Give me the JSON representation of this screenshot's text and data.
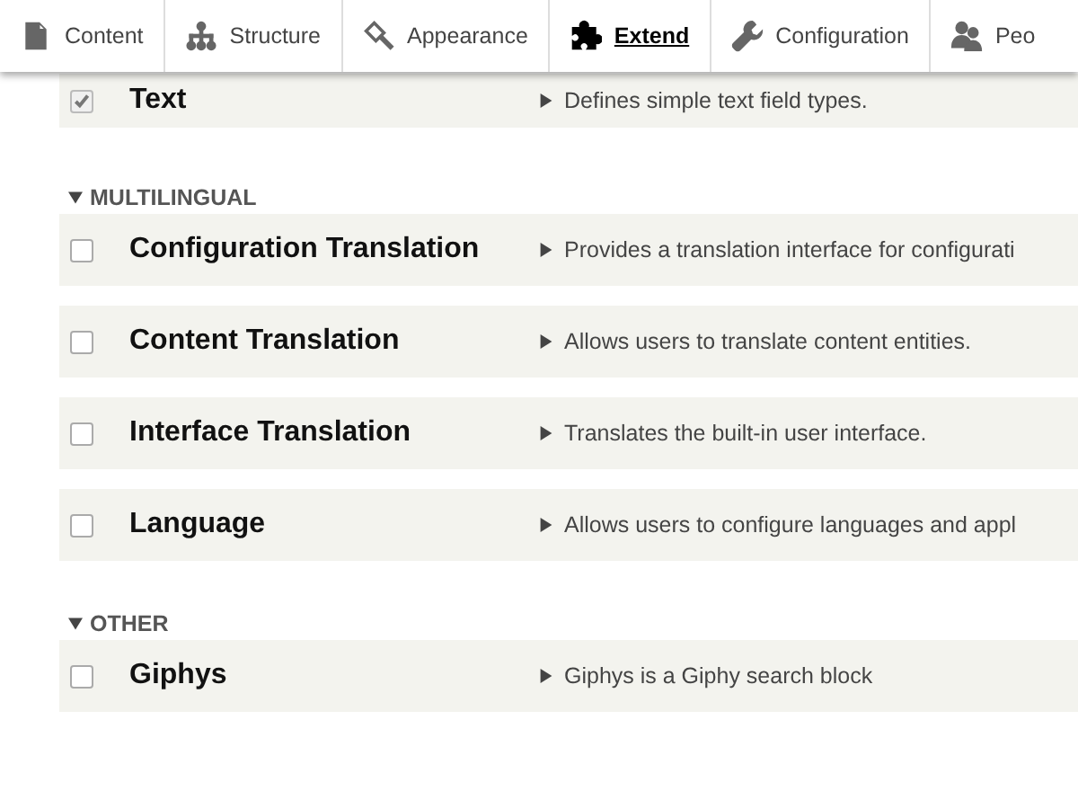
{
  "toolbar": {
    "tabs": [
      {
        "label": "Content",
        "selected": false
      },
      {
        "label": "Structure",
        "selected": false
      },
      {
        "label": "Appearance",
        "selected": false
      },
      {
        "label": "Extend",
        "selected": true
      },
      {
        "label": "Configuration",
        "selected": false
      },
      {
        "label": "Peo",
        "selected": false
      }
    ]
  },
  "groups": [
    {
      "modules": [
        {
          "name": "Text",
          "description": "Defines simple text field types.",
          "checked": true,
          "disabled": true
        }
      ]
    },
    {
      "title": "MULTILINGUAL",
      "modules": [
        {
          "name": "Configuration Translation",
          "description": "Provides a translation interface for configurati",
          "checked": false,
          "disabled": false
        },
        {
          "name": "Content Translation",
          "description": "Allows users to translate content entities.",
          "checked": false,
          "disabled": false
        },
        {
          "name": "Interface Translation",
          "description": "Translates the built-in user interface.",
          "checked": false,
          "disabled": false
        },
        {
          "name": "Language",
          "description": "Allows users to configure languages and appl",
          "checked": false,
          "disabled": false
        }
      ]
    },
    {
      "title": "OTHER",
      "modules": [
        {
          "name": "Giphys",
          "description": "Giphys is a Giphy search block",
          "checked": false,
          "disabled": false
        }
      ]
    }
  ]
}
